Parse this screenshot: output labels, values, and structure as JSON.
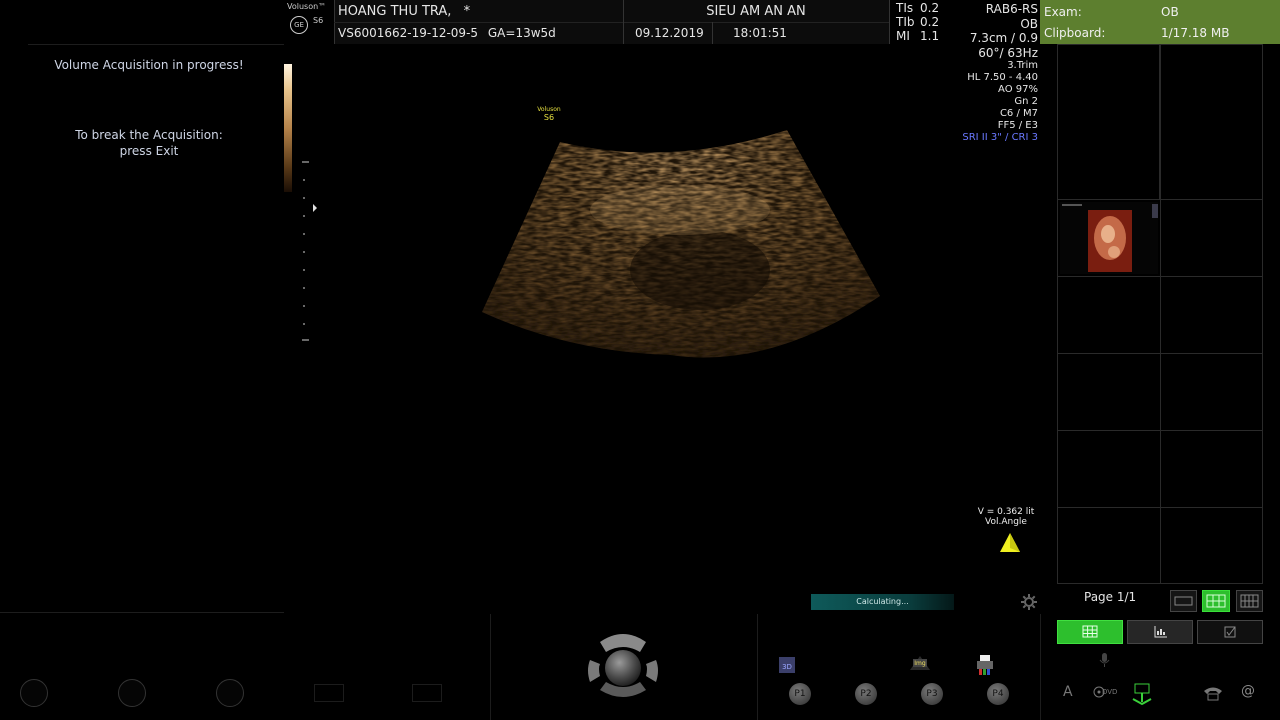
{
  "header": {
    "brand": "Voluson™",
    "model": "S6",
    "logo_text": "GE",
    "patient_name": "HOANG THU TRA,",
    "patient_flag": "*",
    "patient_id": "VS6001662-19-12-09-5",
    "ga": "GA=13w5d",
    "institution": "SIEU AM AN AN",
    "date": "09.12.2019",
    "time": "18:01:51",
    "tis_label": "TIs",
    "tis": "0.2",
    "tib_label": "TIb",
    "tib": "0.2",
    "mi_label": "MI",
    "mi": "1.1"
  },
  "probe_info": {
    "probe": "RAB6-RS",
    "app": "OB",
    "depth": "7.3cm / 0.9",
    "angle": "60°/ 63Hz",
    "preset": "3.Trim",
    "hl": "HL  7.50 - 4.40",
    "ao": "AO 97%",
    "gn": "Gn  2",
    "c": "C6 / M7",
    "ff": "FF5 / E3",
    "sri": "SRI II 3\" / CRI 3",
    "sri_color": "#6a78ff"
  },
  "right_panel": {
    "exam_label": "Exam:",
    "exam_value": "OB",
    "clipboard_label": "Clipboard:",
    "clipboard_value": "1/17.18 MB",
    "header_color": "#5d7f2f",
    "page": "Page 1/1"
  },
  "left_panel": {
    "msg1": "Volume Acquisition in progress!",
    "msg2_line1": "To break the Acquisition:",
    "msg2_line2": "press Exit"
  },
  "image": {
    "watermark_brand": "Voluson",
    "watermark_model": "S6",
    "volume": "V = 0.362 lit",
    "vol_angle": "Vol.Angle",
    "progress_label": "Calculating..."
  },
  "bottom": {
    "p_buttons": [
      "P1",
      "P2",
      "P3",
      "P4"
    ],
    "p_icon_labels": [
      "3D",
      "Img"
    ],
    "text_a": "A",
    "dvd": "DVD",
    "at": "@"
  }
}
